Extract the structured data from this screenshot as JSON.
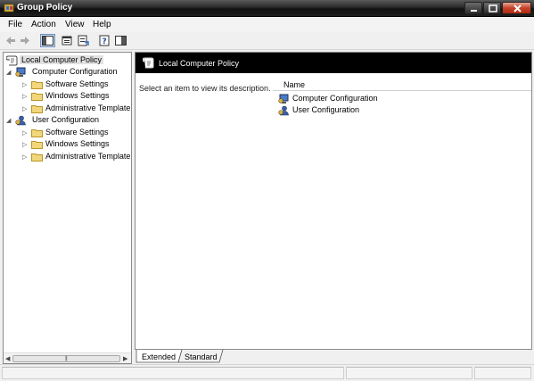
{
  "window": {
    "title": "Group Policy"
  },
  "menu": [
    "File",
    "Action",
    "View",
    "Help"
  ],
  "toolbar": {
    "icons": [
      "back-arrow-icon",
      "forward-arrow-icon",
      "show-hide-tree-icon",
      "properties-icon",
      "export-list-icon",
      "help-icon",
      "show-hide-action-pane-icon"
    ]
  },
  "tree": {
    "root": "Local Computer Policy",
    "computer": {
      "label": "Computer Configuration",
      "children": [
        "Software Settings",
        "Windows Settings",
        "Administrative Template"
      ]
    },
    "user": {
      "label": "User Configuration",
      "children": [
        "Software Settings",
        "Windows Settings",
        "Administrative Template"
      ]
    }
  },
  "details": {
    "header": "Local Computer Policy",
    "description": "Select an item to view its description.",
    "column_name": "Name",
    "items": [
      "Computer Configuration",
      "User Configuration"
    ]
  },
  "tabs": [
    "Extended",
    "Standard"
  ],
  "colors": {
    "header_bg": "#000000",
    "selection": "#e1e1e1",
    "folder": "#e9c64f"
  }
}
